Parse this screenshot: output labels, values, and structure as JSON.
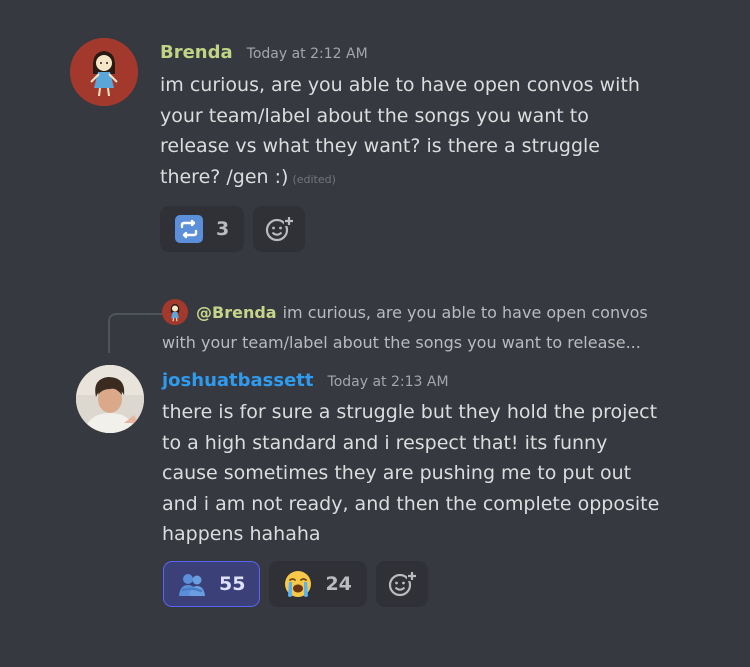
{
  "messages": [
    {
      "username": "Brenda",
      "username_color": "#bfd484",
      "timestamp": "Today at 2:12 AM",
      "lines": [
        "im curious, are you able to have open convos with",
        "your team/label about the songs you want to",
        "release vs what they want? is there a struggle",
        "there? /gen :)"
      ],
      "edited_label": "(edited)",
      "reactions": [
        {
          "emoji": "repeat-icon",
          "count": "3"
        }
      ]
    },
    {
      "username": "joshuatbassett",
      "username_color": "#2f9bef",
      "timestamp": "Today at 2:13 AM",
      "reply": {
        "mention": "@Brenda",
        "preview_line1": "im curious, are you able to have open convos",
        "preview_line2": "with your team/label about the songs you want to release..."
      },
      "lines": [
        "there is for sure a struggle but they hold the project",
        "to a high standard and i respect that! its funny",
        "cause sometimes they are pushing me to put out",
        "and i am not ready, and then the complete opposite",
        "happens hahaha"
      ],
      "reactions": [
        {
          "emoji": "people-hugging-icon",
          "count": "55",
          "me": true
        },
        {
          "emoji": "loudly-crying-face-icon",
          "count": "24"
        }
      ]
    }
  ]
}
